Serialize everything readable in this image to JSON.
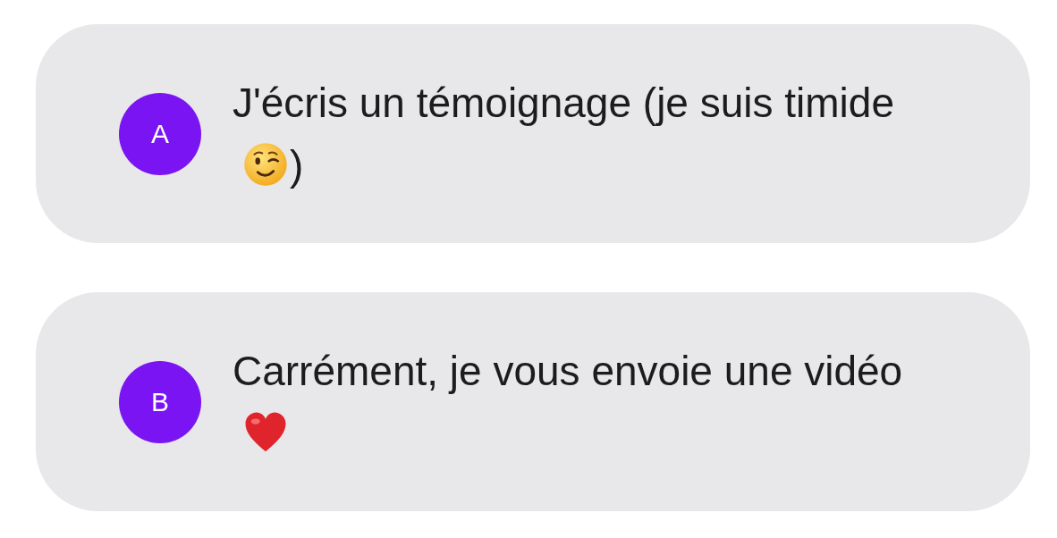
{
  "options": [
    {
      "kind": "wink",
      "letter": "A",
      "text": "J'écris un témoignage (je suis timide",
      "text_after": ")"
    },
    {
      "kind": "heart",
      "letter": "B",
      "text": "Carrément, je vous envoie une vidéo"
    }
  ]
}
